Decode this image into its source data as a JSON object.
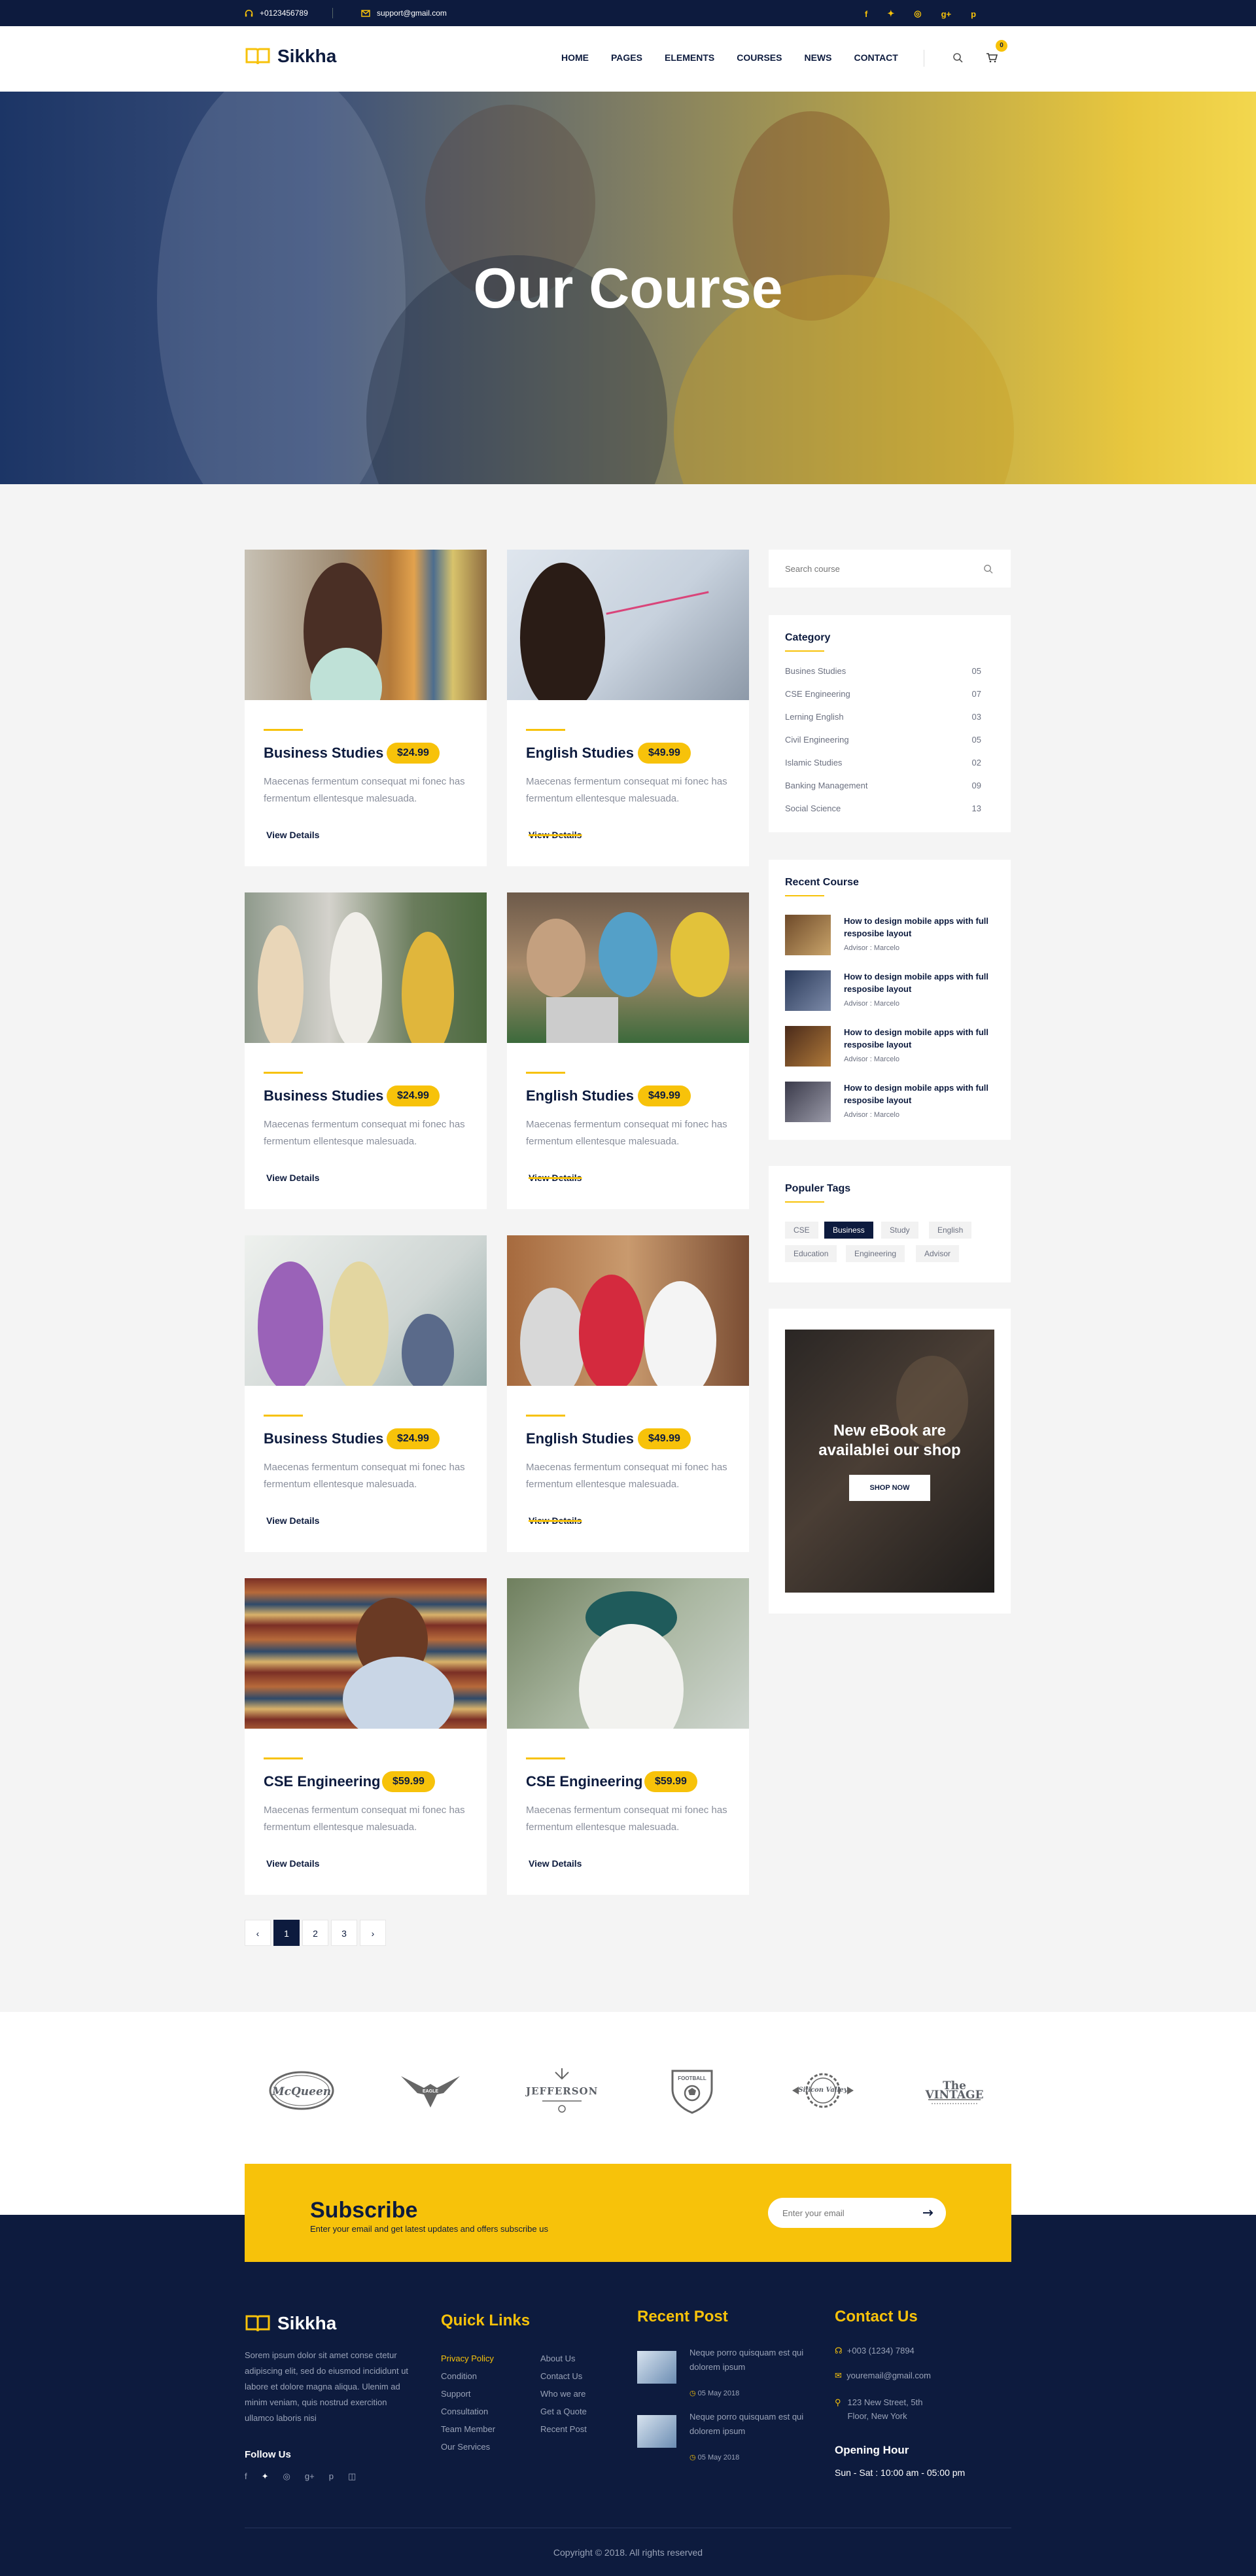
{
  "topbar": {
    "phone": "+0123456789",
    "email": "support@gmail.com"
  },
  "brand": {
    "name": "Sikkha"
  },
  "nav": [
    "HOME",
    "PAGES",
    "ELEMENTS",
    "COURSES",
    "NEWS",
    "CONTACT"
  ],
  "cart": {
    "count": "0"
  },
  "hero": {
    "title": "Our Course"
  },
  "courses": [
    {
      "title": "Business Studies",
      "price": "$24.99",
      "desc": "Maecenas fermentum consequat mi fonec has fermentum ellentesque malesuada.",
      "link": "View Details"
    },
    {
      "title": "English Studies",
      "price": "$49.99",
      "desc": "Maecenas fermentum consequat mi fonec has fermentum ellentesque malesuada.",
      "link": "View Details"
    },
    {
      "title": "Business Studies",
      "price": "$24.99",
      "desc": "Maecenas fermentum consequat mi fonec has fermentum ellentesque malesuada.",
      "link": "View Details"
    },
    {
      "title": "English Studies",
      "price": "$49.99",
      "desc": "Maecenas fermentum consequat mi fonec has fermentum ellentesque malesuada.",
      "link": "View Details"
    },
    {
      "title": "Business Studies",
      "price": "$24.99",
      "desc": "Maecenas fermentum consequat mi fonec has fermentum ellentesque malesuada.",
      "link": "View Details"
    },
    {
      "title": "English Studies",
      "price": "$49.99",
      "desc": "Maecenas fermentum consequat mi fonec has fermentum ellentesque malesuada.",
      "link": "View Details"
    },
    {
      "title": "CSE Engineering",
      "price": "$59.99",
      "desc": "Maecenas fermentum consequat mi fonec has fermentum ellentesque malesuada.",
      "link": "View Details"
    },
    {
      "title": "CSE Engineering",
      "price": "$59.99",
      "desc": "Maecenas fermentum consequat mi fonec has fermentum ellentesque malesuada.",
      "link": "View Details"
    }
  ],
  "pagination": [
    "1",
    "2",
    "3"
  ],
  "search": {
    "placeholder": "Search course"
  },
  "category": {
    "title": "Category",
    "items": [
      {
        "name": "Busines Studies",
        "count": "05"
      },
      {
        "name": "CSE Engineering",
        "count": "07"
      },
      {
        "name": "Lerning English",
        "count": "03"
      },
      {
        "name": "Civil Engineering",
        "count": "05"
      },
      {
        "name": "Islamic Studies",
        "count": "02"
      },
      {
        "name": "Banking Management",
        "count": "09"
      },
      {
        "name": "Social Science",
        "count": "13"
      }
    ]
  },
  "recent": {
    "title": "Recent Course",
    "items": [
      {
        "title": "How to design mobile apps with full resposibe layout",
        "advisor": "Advisor : Marcelo"
      },
      {
        "title": "How to design mobile apps with full resposibe layout",
        "advisor": "Advisor : Marcelo"
      },
      {
        "title": "How to design mobile apps with full resposibe layout",
        "advisor": "Advisor : Marcelo"
      },
      {
        "title": "How to design mobile apps with full resposibe layout",
        "advisor": "Advisor : Marcelo"
      }
    ]
  },
  "tags": {
    "title": "Populer Tags",
    "items": [
      "CSE",
      "Business",
      "Study",
      "English",
      "Education",
      "Engineering",
      "Advisor"
    ]
  },
  "promo": {
    "title": "New eBook are availablei our shop",
    "button": "SHOP NOW"
  },
  "brands": [
    "McQueen",
    "EAGLE",
    "JEFFERSON",
    "FOOTBALL",
    "Silicon Valley",
    "The VINTAGE"
  ],
  "subscribe": {
    "title": "Subscribe",
    "text": "Enter your email and get latest updates and offers subscribe us",
    "placeholder": "Enter your email"
  },
  "footer": {
    "about": "Sorem ipsum dolor sit amet conse ctetur adipiscing elit, sed do eiusmod incididunt ut labore et dolore magna aliqua. Ulenim ad minim veniam, quis nostrud exercition ullamco laboris nisi",
    "follow": "Follow Us",
    "quick_title": "Quick Links",
    "quick_col1": [
      "Privacy Policy",
      "Condition",
      "Support",
      "Consultation",
      "Team Member",
      "Our Services"
    ],
    "quick_col2": [
      "About Us",
      "Contact Us",
      "Who we are",
      "Get a Quote",
      "Recent Post"
    ],
    "recent_title": "Recent Post",
    "posts": [
      {
        "text": "Neque porro quisquam est qui dolorem ipsum",
        "date": "05 May 2018"
      },
      {
        "text": "Neque porro quisquam est qui dolorem ipsum",
        "date": "05 May 2018"
      }
    ],
    "contact_title": "Contact Us",
    "phone": "+003 (1234) 7894",
    "email": "youremail@gmail.com",
    "address": "123 New Street, 5th Floor, New York",
    "opening_title": "Opening Hour",
    "opening": "Sun - Sat : 10:00 am - 05:00 pm",
    "copyright": "Copyright © 2018. All rights reserved"
  },
  "colors": {
    "navy": "#0d1b3e",
    "accent": "#f7c20a"
  }
}
